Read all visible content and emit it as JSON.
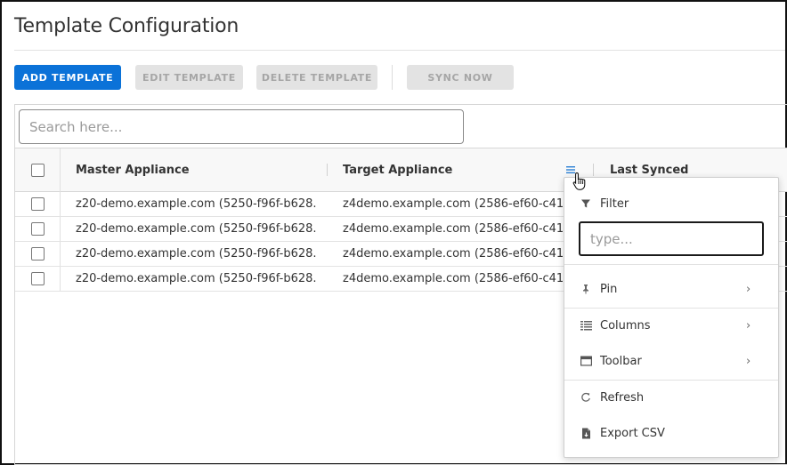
{
  "page": {
    "title": "Template Configuration"
  },
  "toolbar": {
    "add_label": "ADD TEMPLATE",
    "edit_label": "EDIT TEMPLATE",
    "delete_label": "DELETE TEMPLATE",
    "sync_label": "SYNC NOW"
  },
  "search": {
    "placeholder": "Search here...",
    "value": ""
  },
  "grid": {
    "columns": [
      "Master Appliance",
      "Target Appliance",
      "Last Synced"
    ],
    "rows": [
      {
        "master": "z20-demo.example.com (5250-f96f-b628...",
        "target": "z4demo.example.com (2586-ef60-c417-7"
      },
      {
        "master": "z20-demo.example.com (5250-f96f-b628...",
        "target": "z4demo.example.com (2586-ef60-c417-7"
      },
      {
        "master": "z20-demo.example.com (5250-f96f-b628...",
        "target": "z4demo.example.com (2586-ef60-c417-7"
      },
      {
        "master": "z20-demo.example.com (5250-f96f-b628...",
        "target": "z4demo.example.com (2586-ef60-c417-7"
      }
    ]
  },
  "column_menu": {
    "filter_label": "Filter",
    "filter_placeholder": "type...",
    "items": [
      {
        "label": "Pin",
        "icon": "pin-icon"
      },
      {
        "label": "Columns",
        "icon": "columns-icon"
      },
      {
        "label": "Toolbar",
        "icon": "toolbar-icon"
      },
      {
        "label": "Refresh",
        "icon": "refresh-icon"
      },
      {
        "label": "Export CSV",
        "icon": "export-csv-icon"
      }
    ]
  },
  "colors": {
    "primary": "#0b72d8",
    "disabled_bg": "#e3e3e3",
    "disabled_text": "#a6a6a6",
    "accent_icon": "#2a7fd4"
  }
}
